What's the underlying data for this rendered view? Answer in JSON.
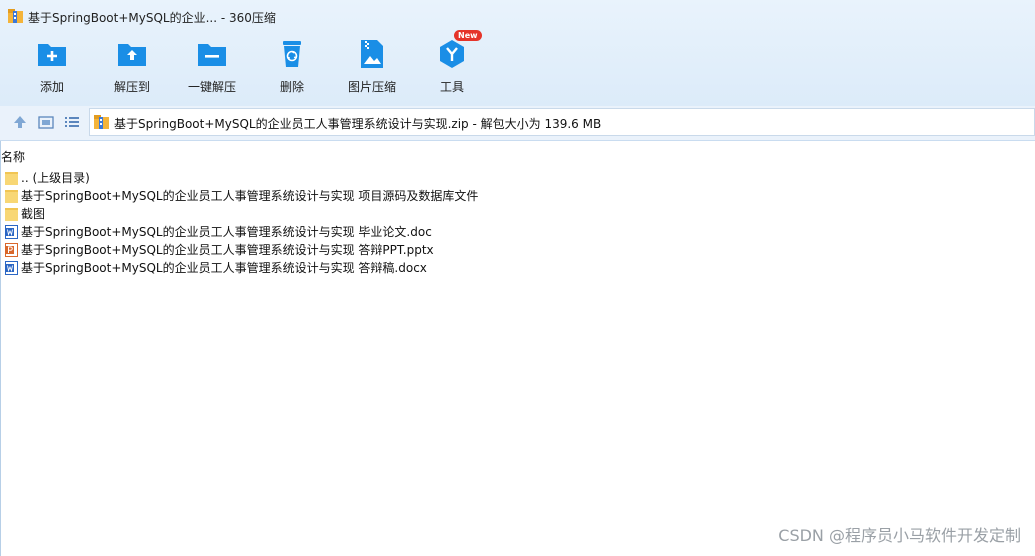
{
  "window": {
    "title": "基于SpringBoot+MySQL的企业... - 360压缩"
  },
  "toolbar": {
    "items": [
      {
        "label": "添加",
        "icon": "add-icon"
      },
      {
        "label": "解压到",
        "icon": "extract-to-icon"
      },
      {
        "label": "一键解压",
        "icon": "one-click-extract-icon"
      },
      {
        "label": "删除",
        "icon": "delete-icon"
      },
      {
        "label": "图片压缩",
        "icon": "image-compress-icon"
      },
      {
        "label": "工具",
        "icon": "tools-icon",
        "badge": "New"
      }
    ]
  },
  "nav": {
    "path": "基于SpringBoot+MySQL的企业员工人事管理系统设计与实现.zip - 解包大小为 139.6 MB"
  },
  "list": {
    "column_name": "名称",
    "files": [
      {
        "name": ".. (上级目录)",
        "type": "folder"
      },
      {
        "name": "基于SpringBoot+MySQL的企业员工人事管理系统设计与实现 项目源码及数据库文件",
        "type": "folder"
      },
      {
        "name": "截图",
        "type": "folder"
      },
      {
        "name": "基于SpringBoot+MySQL的企业员工人事管理系统设计与实现 毕业论文.doc",
        "type": "word"
      },
      {
        "name": "基于SpringBoot+MySQL的企业员工人事管理系统设计与实现 答辩PPT.pptx",
        "type": "ppt"
      },
      {
        "name": "基于SpringBoot+MySQL的企业员工人事管理系统设计与实现 答辩稿.docx",
        "type": "word"
      }
    ]
  },
  "watermark": "CSDN @程序员小马软件开发定制",
  "colors": {
    "accent": "#1a8ee6",
    "folder": "#f8d775",
    "word": "#2b66c4",
    "ppt": "#d9672b",
    "badge": "#e5342a"
  }
}
